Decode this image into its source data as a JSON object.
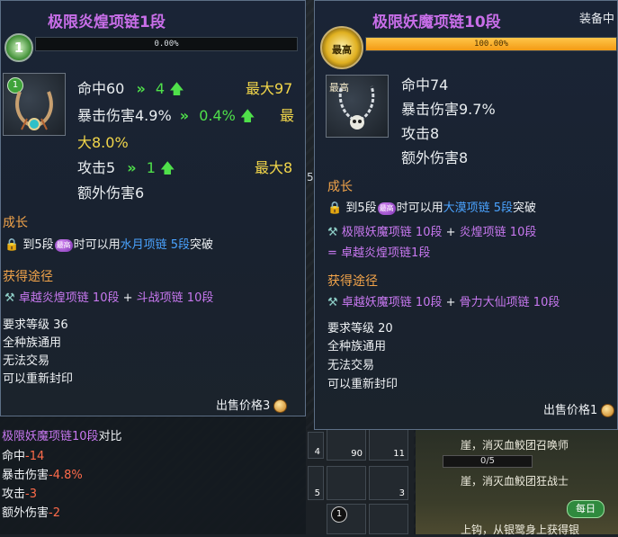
{
  "colors": {
    "title_purple": "#c86ee8",
    "green": "#4fe04a",
    "yellow": "#f2d64a",
    "red": "#ff6b4a",
    "orange": "#f2a44a",
    "blue": "#4aa3ff",
    "progress": "#f39a13"
  },
  "left": {
    "title": "极限炎煌项链1段",
    "level_badge": "1",
    "progress": {
      "label": "0.00%",
      "value": 0.0
    },
    "icon_badge": "1",
    "stats": [
      {
        "text": "命中60",
        "arrow": "»",
        "inc": "4",
        "max": "最大97"
      },
      {
        "text": "暴击伤害4.9%",
        "arrow": "»",
        "inc": "0.4%",
        "max": "最",
        "max_cont": "大8.0%"
      },
      {
        "text": "攻击5",
        "arrow": "»",
        "inc": "1",
        "max": "最大8"
      },
      {
        "text": "额外伤害6"
      }
    ],
    "growth": {
      "title": "成长",
      "pre": "到5段",
      "grade": "最高",
      "mid": "时可以用",
      "target": "水月项链 5段",
      "post": "突破"
    },
    "source": {
      "title": "获得途径",
      "item1": "卓越炎煌项链 10段",
      "plus": "+",
      "item2": "斗战项链 10段"
    },
    "info": [
      "要求等级 36",
      "全种族通用",
      "无法交易",
      "可以重新封印"
    ],
    "price_label": "出售价格3",
    "compare": {
      "title": "极限妖魔项链10段",
      "suffix": "对比",
      "rows": [
        {
          "name": "命中",
          "val": "-14"
        },
        {
          "name": "暴击伤害",
          "val": "-4.8%"
        },
        {
          "name": "攻击",
          "val": "-3"
        },
        {
          "name": "额外伤害",
          "val": "-2"
        }
      ]
    }
  },
  "right": {
    "title": "极限妖魔项链10段",
    "equipped": "装备中",
    "level_badge": "最高",
    "progress": {
      "label": "100.00%",
      "value": 1.0
    },
    "icon_badge": "最高",
    "stats": [
      "命中74",
      "暴击伤害9.7%",
      "攻击8",
      "额外伤害8"
    ],
    "growth": {
      "title": "成长",
      "pre": "到5段",
      "grade": "最高",
      "mid": "时可以用",
      "target": "大漠项链 5段",
      "post": "突破",
      "combo1": "极限妖魔项链 10段",
      "plus": "+",
      "combo2": "炎煌项链 10段",
      "eq": "=",
      "result": "卓越炎煌项链1段"
    },
    "source": {
      "title": "获得途径",
      "item1": "卓越妖魔项链 10段",
      "plus": "+",
      "item2": "骨力大仙项链 10段"
    },
    "info": [
      "要求等级 20",
      "全种族通用",
      "无法交易",
      "可以重新封印"
    ],
    "price_label": "出售价格1"
  },
  "background": {
    "slots": [
      "4",
      "90",
      "11",
      "5",
      "3",
      "1"
    ],
    "peek_number": "5",
    "quest1": "崖，消灭血鲛团召唤师",
    "quest_progress": "0/5",
    "quest2": "崖，消灭血鲛团狂战士",
    "quest3": "上钩，从银鹭身上获得银",
    "daily_badge": "每日"
  }
}
